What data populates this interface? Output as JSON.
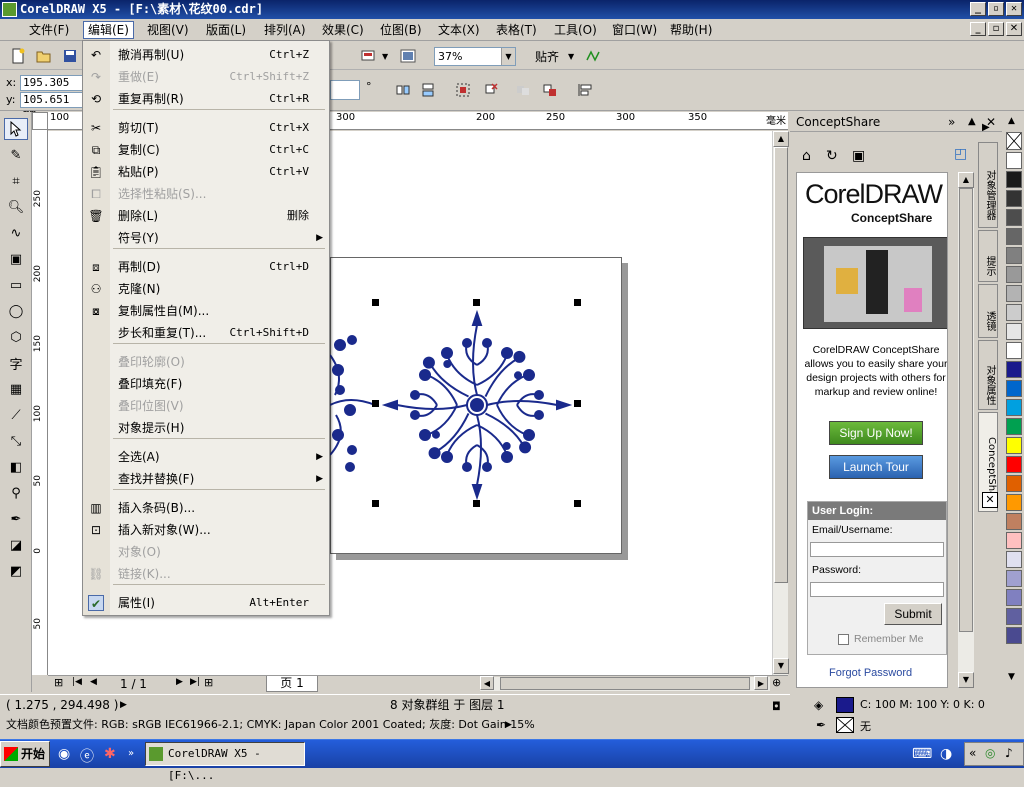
{
  "window": {
    "title": "CorelDRAW X5 - [F:\\素材\\花纹00.cdr]",
    "btn_min": "_",
    "btn_max": "▫",
    "btn_close": "✕"
  },
  "menubar": {
    "items": [
      "文件(F)",
      "编辑(E)",
      "视图(V)",
      "版面(L)",
      "排列(A)",
      "效果(C)",
      "位图(B)",
      "文本(X)",
      "表格(T)",
      "工具(O)",
      "窗口(W)",
      "帮助(H)"
    ]
  },
  "toolbar": {
    "zoom": "37%",
    "snap_label": "贴齐",
    "x_label": "x:",
    "x_value": "195.305 mm",
    "y_label": "y:",
    "y_value": "105.651 mm",
    "degree": "°"
  },
  "edit_menu": [
    {
      "label": "撤消再制(U)",
      "shortcut": "Ctrl+Z",
      "icon": "undo-icon",
      "disabled": false
    },
    {
      "label": "重做(E)",
      "shortcut": "Ctrl+Shift+Z",
      "icon": "redo-icon",
      "disabled": true
    },
    {
      "label": "重复再制(R)",
      "shortcut": "Ctrl+R",
      "icon": "repeat-icon",
      "disabled": false
    },
    {
      "label": "剪切(T)",
      "shortcut": "Ctrl+X",
      "icon": "scissors-icon",
      "disabled": false
    },
    {
      "label": "复制(C)",
      "shortcut": "Ctrl+C",
      "icon": "copy-icon",
      "disabled": false
    },
    {
      "label": "粘贴(P)",
      "shortcut": "Ctrl+V",
      "icon": "paste-icon",
      "disabled": false
    },
    {
      "label": "选择性粘贴(S)...",
      "shortcut": "",
      "icon": "paste-special-icon",
      "disabled": true
    },
    {
      "label": "删除(L)",
      "shortcut": "删除",
      "icon": "trash-icon",
      "disabled": false
    },
    {
      "label": "符号(Y)",
      "shortcut": "",
      "icon": "",
      "disabled": false,
      "submenu": true
    },
    {
      "label": "再制(D)",
      "shortcut": "Ctrl+D",
      "icon": "duplicate-icon",
      "disabled": false
    },
    {
      "label": "克隆(N)",
      "shortcut": "",
      "icon": "clone-icon",
      "disabled": false
    },
    {
      "label": "复制属性自(M)...",
      "shortcut": "",
      "icon": "copy-properties-icon",
      "disabled": false
    },
    {
      "label": "步长和重复(T)...",
      "shortcut": "Ctrl+Shift+D",
      "icon": "",
      "disabled": false
    },
    {
      "label": "叠印轮廓(O)",
      "shortcut": "",
      "icon": "",
      "disabled": true
    },
    {
      "label": "叠印填充(F)",
      "shortcut": "",
      "icon": "",
      "disabled": false
    },
    {
      "label": "叠印位图(V)",
      "shortcut": "",
      "icon": "",
      "disabled": true
    },
    {
      "label": "对象提示(H)",
      "shortcut": "",
      "icon": "",
      "disabled": false
    },
    {
      "label": "全选(A)",
      "shortcut": "",
      "icon": "",
      "disabled": false,
      "submenu": true
    },
    {
      "label": "查找并替换(F)",
      "shortcut": "",
      "icon": "",
      "disabled": false,
      "submenu": true
    },
    {
      "label": "插入条码(B)...",
      "shortcut": "",
      "icon": "barcode-icon",
      "disabled": false
    },
    {
      "label": "插入新对象(W)...",
      "shortcut": "",
      "icon": "insert-object-icon",
      "disabled": false
    },
    {
      "label": "对象(O)",
      "shortcut": "",
      "icon": "",
      "disabled": true
    },
    {
      "label": "链接(K)...",
      "shortcut": "",
      "icon": "link-icon",
      "disabled": true
    },
    {
      "label": "属性(I)",
      "shortcut": "Alt+Enter",
      "icon": "check-icon",
      "disabled": false
    }
  ],
  "rulers": {
    "h": [
      "100",
      "300",
      "200",
      "250",
      "300",
      "350",
      "毫米"
    ],
    "v": [
      "250",
      "200",
      "150",
      "100",
      "50",
      "0",
      "50"
    ]
  },
  "pagebar": {
    "count": "1 / 1",
    "tab": "页 1"
  },
  "status": {
    "coords": "( 1.275 , 294.498 )",
    "selection": "8 对象群组 于 图层 1",
    "profile": "文档颜色预置文件: RGB: sRGB IEC61966-2.1; CMYK: Japan Color 2001 Coated; 灰度: Dot Gain 15%",
    "fill": "C: 100 M: 100 Y: 0 K: 0",
    "outline": "无",
    "fill_color": "#1a1a8c"
  },
  "docker": {
    "title": "ConceptShare",
    "tabs": [
      "对象管理器",
      "提示",
      "透镜",
      "对象属性",
      "ConceptShare"
    ]
  },
  "conceptshare": {
    "logo_main": "CorelDRAW",
    "logo_sub": "ConceptShare",
    "description": "CorelDRAW ConceptShare allows you to easily share your design projects with others for markup and review online!",
    "signup": "Sign Up Now!",
    "tour": "Launch Tour",
    "login_header": "User Login:",
    "email_label": "Email/Username:",
    "password_label": "Password:",
    "submit": "Submit",
    "remember": "Remember Me",
    "forgot": "Forgot Password"
  },
  "taskbar": {
    "start": "开始",
    "item": "CorelDRAW X5 - [F:\\..."
  },
  "colors": {
    "ornament": "#1a2a8c",
    "palette": [
      "#ffffff",
      "#1a1a1a",
      "#333333",
      "#4d4d4d",
      "#666666",
      "#808080",
      "#999999",
      "#b3b3b3",
      "#cccccc",
      "#e6e6e6",
      "#ffffff",
      "#1a1a8c",
      "#0066cc",
      "#00a0e0",
      "#00a050",
      "#ffff00",
      "#ff0000",
      "#e06000",
      "#ff9900",
      "#c08060",
      "#ffc0c0",
      "#e0e0f0",
      "#a0a0d0",
      "#8080c0",
      "#6060a0",
      "#4a4a90"
    ]
  }
}
